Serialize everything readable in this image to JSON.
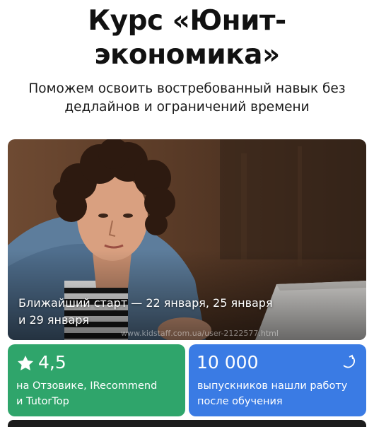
{
  "header": {
    "title_line1": "Курс «Юнит-",
    "title_line2": "экономика»",
    "subtitle_line1": "Поможем освоить востребованный навык без",
    "subtitle_line2": "дедлайнов и ограничений времени"
  },
  "hero": {
    "caption_line1": "Ближайший старт — 22 января, 25 января",
    "caption_line2": "и 29 января",
    "watermark": "www.kidstaff.com.ua/user-2122577.html"
  },
  "stats": [
    {
      "value": "4,5",
      "text_line1": "на Отзовике, IRecommend",
      "text_line2": "и TutorTop",
      "icon": "star-icon",
      "color": "#2fa56b"
    },
    {
      "value": "10 000",
      "text_line1": "выпускников нашли работу",
      "text_line2": "после обучения",
      "icon": "curved-arrow-icon",
      "color": "#3a7be4"
    }
  ]
}
